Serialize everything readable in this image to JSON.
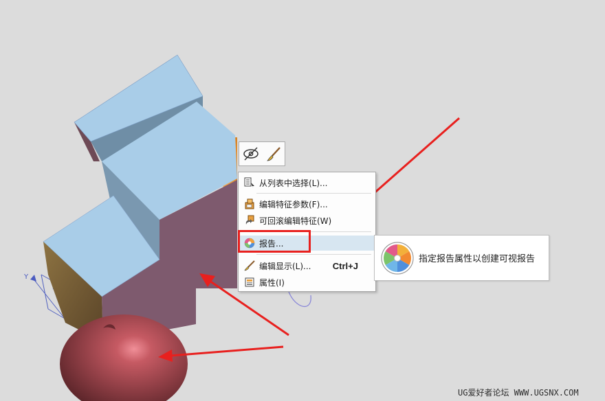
{
  "mini_toolbar": {
    "buttons": [
      {
        "icon": "eye-hide-icon"
      },
      {
        "icon": "paintbrush-icon"
      }
    ]
  },
  "context_menu": {
    "items": [
      {
        "label": "从列表中选择(L)...",
        "icon": "list-select-icon"
      },
      {
        "label": "编辑特征参数(F)...",
        "icon": "edit-feature-params-icon"
      },
      {
        "label": "可回滚编辑特征(W)",
        "icon": "rollback-edit-icon"
      },
      {
        "label": "报告...",
        "icon": "report-icon"
      },
      {
        "label": "编辑显示(L)...",
        "shortcut": "Ctrl+J",
        "icon": "edit-display-icon"
      },
      {
        "label": "属性(I)",
        "icon": "properties-icon"
      }
    ]
  },
  "tooltip": {
    "text": "指定报告属性以创建可视报告",
    "icon": "report-wheel-icon"
  },
  "axis": {
    "y_label": "Y"
  },
  "watermark": "UG爱好者论坛 WWW.UGSNX.COM",
  "colors": {
    "highlight_box": "#e8201e",
    "arrow": "#e8201e",
    "top_faces": "#a9cde8",
    "front_faces": "#7e5a6e",
    "side_face": "#6b5432",
    "sphere": "#8b3c40",
    "background": "#dcdcdc"
  }
}
